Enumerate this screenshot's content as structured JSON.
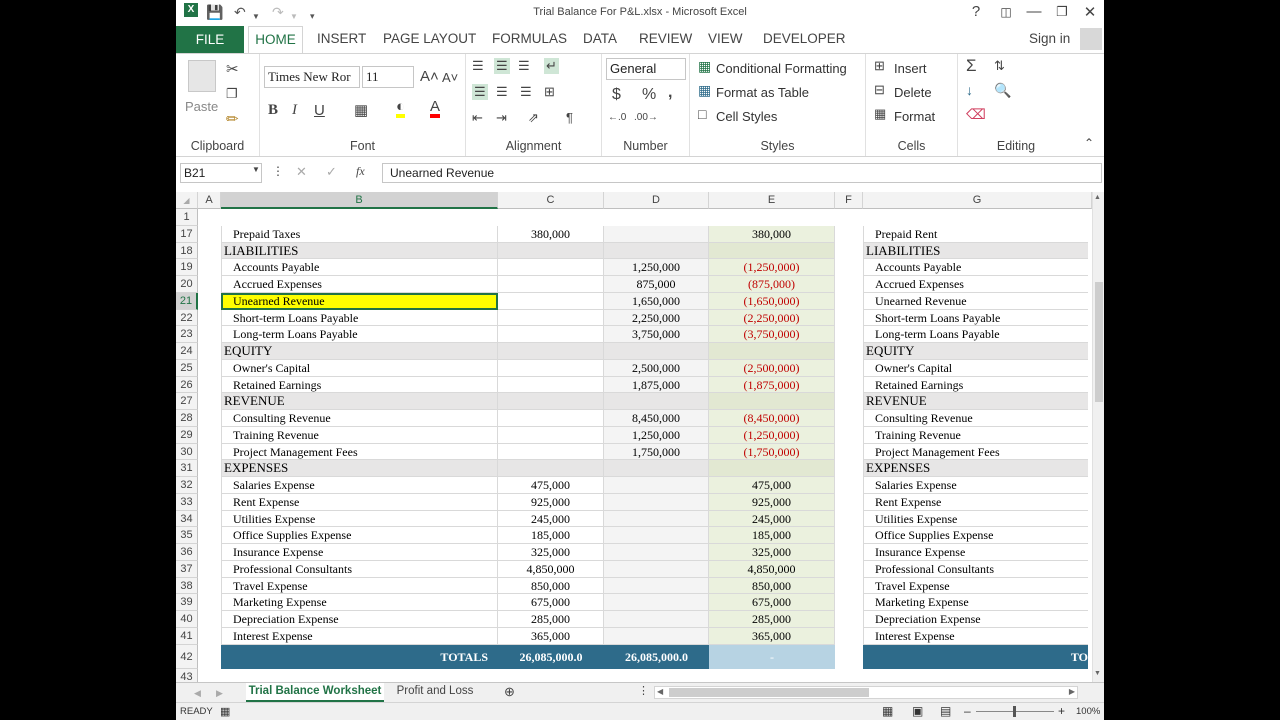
{
  "window": {
    "title": "Trial Balance For P&L.xlsx - Microsoft Excel"
  },
  "ribbon_tabs": [
    "FILE",
    "HOME",
    "INSERT",
    "PAGE LAYOUT",
    "FORMULAS",
    "DATA",
    "REVIEW",
    "VIEW",
    "DEVELOPER"
  ],
  "signin": "Sign in",
  "clipboard": {
    "paste": "Paste",
    "label": "Clipboard"
  },
  "font": {
    "name": "Times New Ror",
    "size": "11",
    "label": "Font",
    "bold": "B",
    "italic": "I",
    "underline": "U"
  },
  "alignment": {
    "label": "Alignment"
  },
  "number": {
    "format": "General",
    "label": "Number",
    "currency": "$",
    "percent": "%",
    "comma": ","
  },
  "styles": {
    "conditional": "Conditional Formatting",
    "table": "Format as Table",
    "cell": "Cell Styles",
    "label": "Styles"
  },
  "cells": {
    "insert": "Insert",
    "delete": "Delete",
    "format": "Format",
    "label": "Cells"
  },
  "editing": {
    "label": "Editing"
  },
  "formula_bar": {
    "name_box": "B21",
    "content": "Unearned Revenue",
    "fx": "fx"
  },
  "columns": [
    "A",
    "B",
    "C",
    "D",
    "E",
    "F",
    "G"
  ],
  "rows": [
    {
      "n": "1",
      "label": "",
      "c": "",
      "d": "",
      "e": "",
      "g": "",
      "type": "blank"
    },
    {
      "n": "17",
      "label": "Prepaid Taxes",
      "c": "380,000",
      "d": "",
      "e": "380,000",
      "g": "Prepaid Rent",
      "type": "item"
    },
    {
      "n": "18",
      "label": "LIABILITIES",
      "c": "",
      "d": "",
      "e": "",
      "g": "LIABILITIES",
      "type": "header"
    },
    {
      "n": "19",
      "label": "Accounts Payable",
      "c": "",
      "d": "1,250,000",
      "e": "(1,250,000)",
      "g": "Accounts Payable",
      "type": "item"
    },
    {
      "n": "20",
      "label": "Accrued Expenses",
      "c": "",
      "d": "875,000",
      "e": "(875,000)",
      "g": "Accrued Expenses",
      "type": "item"
    },
    {
      "n": "21",
      "label": "Unearned Revenue",
      "c": "",
      "d": "1,650,000",
      "e": "(1,650,000)",
      "g": "Unearned Revenue",
      "type": "item"
    },
    {
      "n": "22",
      "label": "Short-term Loans Payable",
      "c": "",
      "d": "2,250,000",
      "e": "(2,250,000)",
      "g": "Short-term Loans Payable",
      "type": "item"
    },
    {
      "n": "23",
      "label": "Long-term Loans Payable",
      "c": "",
      "d": "3,750,000",
      "e": "(3,750,000)",
      "g": "Long-term Loans Payable",
      "type": "item"
    },
    {
      "n": "24",
      "label": "EQUITY",
      "c": "",
      "d": "",
      "e": "",
      "g": "EQUITY",
      "type": "header"
    },
    {
      "n": "25",
      "label": "Owner's Capital",
      "c": "",
      "d": "2,500,000",
      "e": "(2,500,000)",
      "g": "Owner's Capital",
      "type": "item"
    },
    {
      "n": "26",
      "label": "Retained Earnings",
      "c": "",
      "d": "1,875,000",
      "e": "(1,875,000)",
      "g": "Retained Earnings",
      "type": "item"
    },
    {
      "n": "27",
      "label": "REVENUE",
      "c": "",
      "d": "",
      "e": "",
      "g": "REVENUE",
      "type": "header"
    },
    {
      "n": "28",
      "label": "Consulting Revenue",
      "c": "",
      "d": "8,450,000",
      "e": "(8,450,000)",
      "g": "Consulting Revenue",
      "type": "item"
    },
    {
      "n": "29",
      "label": "Training Revenue",
      "c": "",
      "d": "1,250,000",
      "e": "(1,250,000)",
      "g": "Training Revenue",
      "type": "item"
    },
    {
      "n": "30",
      "label": "Project Management Fees",
      "c": "",
      "d": "1,750,000",
      "e": "(1,750,000)",
      "g": "Project Management Fees",
      "type": "item"
    },
    {
      "n": "31",
      "label": "EXPENSES",
      "c": "",
      "d": "",
      "e": "",
      "g": "EXPENSES",
      "type": "header"
    },
    {
      "n": "32",
      "label": "Salaries Expense",
      "c": "475,000",
      "d": "",
      "e": "475,000",
      "g": "Salaries Expense",
      "type": "item"
    },
    {
      "n": "33",
      "label": "Rent Expense",
      "c": "925,000",
      "d": "",
      "e": "925,000",
      "g": "Rent Expense",
      "type": "item"
    },
    {
      "n": "34",
      "label": "Utilities Expense",
      "c": "245,000",
      "d": "",
      "e": "245,000",
      "g": "Utilities Expense",
      "type": "item"
    },
    {
      "n": "35",
      "label": "Office Supplies Expense",
      "c": "185,000",
      "d": "",
      "e": "185,000",
      "g": "Office Supplies Expense",
      "type": "item"
    },
    {
      "n": "36",
      "label": "Insurance Expense",
      "c": "325,000",
      "d": "",
      "e": "325,000",
      "g": "Insurance Expense",
      "type": "item"
    },
    {
      "n": "37",
      "label": "Professional Consultants",
      "c": "4,850,000",
      "d": "",
      "e": "4,850,000",
      "g": "Professional Consultants",
      "type": "item"
    },
    {
      "n": "38",
      "label": "Travel Expense",
      "c": "850,000",
      "d": "",
      "e": "850,000",
      "g": "Travel Expense",
      "type": "item"
    },
    {
      "n": "39",
      "label": "Marketing Expense",
      "c": "675,000",
      "d": "",
      "e": "675,000",
      "g": "Marketing Expense",
      "type": "item"
    },
    {
      "n": "40",
      "label": "Depreciation Expense",
      "c": "285,000",
      "d": "",
      "e": "285,000",
      "g": "Depreciation Expense",
      "type": "item"
    },
    {
      "n": "41",
      "label": "Interest Expense",
      "c": "365,000",
      "d": "",
      "e": "365,000",
      "g": "Interest Expense",
      "type": "item"
    },
    {
      "n": "42",
      "label": "TOTALS",
      "c": "26,085,000.0",
      "d": "26,085,000.0",
      "e": "-",
      "g": "TO",
      "type": "total"
    },
    {
      "n": "43",
      "label": "",
      "c": "",
      "d": "",
      "e": "",
      "g": "",
      "type": "blank"
    }
  ],
  "selected_row": "21",
  "sheets": [
    "Trial Balance Worksheet",
    "Profit and Loss"
  ],
  "status": {
    "ready": "READY",
    "zoom": "100%"
  },
  "colors": {
    "accent": "#217346",
    "header_fill": "#e7e6e6",
    "total_fill": "#2e6b8a",
    "selection": "#ffff00",
    "col_e_fill": "#ebf1de",
    "negative": "#c00000"
  }
}
